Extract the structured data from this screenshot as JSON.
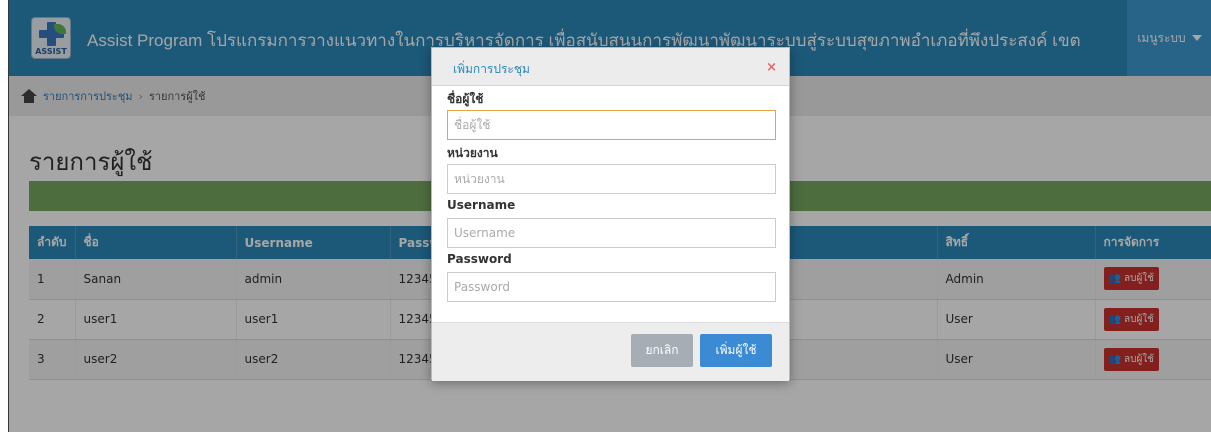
{
  "header": {
    "logo_text": "ASSIST",
    "title": "Assist Program โปรแกรมการวางแนวทางในการบริหารจัดการ เพื่อสนับสนุนการพัฒนาพัฒนาระบบสู่ระบบสุขภาพอำเภอที่พึงประสงค์ เขต",
    "system_menu": "เมนูระบบ"
  },
  "breadcrumb": {
    "items": [
      "รายการการประชุม",
      "รายการผู้ใช้"
    ],
    "separator": "›"
  },
  "page": {
    "title": "รายการผู้ใช้"
  },
  "table": {
    "columns": [
      "ลำดับ",
      "ชื่อ",
      "Username",
      "Password",
      "",
      "สิทธิ์",
      "การจัดการ"
    ],
    "rows": [
      {
        "no": "1",
        "name": "Sanan",
        "username": "admin",
        "password": "12345",
        "role": "Admin",
        "action": "ลบผู้ใช้"
      },
      {
        "no": "2",
        "name": "user1",
        "username": "user1",
        "password": "12345",
        "role": "User",
        "action": "ลบผู้ใช้"
      },
      {
        "no": "3",
        "name": "user2",
        "username": "user2",
        "password": "12345",
        "role": "User",
        "action": "ลบผู้ใช้"
      }
    ]
  },
  "modal": {
    "title": "เพิ่มการประชุม",
    "close_glyph": "×",
    "fields": [
      {
        "label": "ชื่อผู้ใช้",
        "placeholder": "ชื่อผู้ใช้"
      },
      {
        "label": "หน่วยงาน",
        "placeholder": "หน่วยงาน"
      },
      {
        "label": "Username",
        "placeholder": "Username"
      },
      {
        "label": "Password",
        "placeholder": "Password"
      }
    ],
    "cancel_label": "ยกเลิก",
    "submit_label": "เพิ่มผู้ใช้"
  },
  "colors": {
    "navbar": "#2b87b9",
    "green_bar": "#77a861",
    "danger": "#c9302c",
    "primary": "#3a8ad4"
  }
}
